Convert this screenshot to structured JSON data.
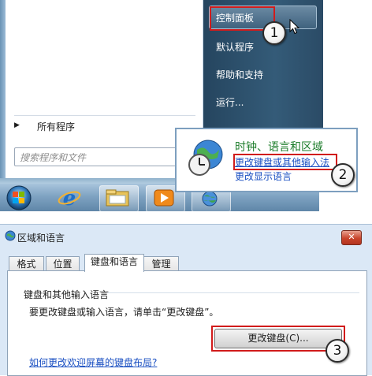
{
  "start_menu": {
    "right_items": [
      {
        "label": "控制面板"
      },
      {
        "label": "默认程序"
      },
      {
        "label": "帮助和支持"
      },
      {
        "label": "运行..."
      }
    ],
    "all_programs_label": "所有程序",
    "search_placeholder": "搜索程序和文件"
  },
  "flyout": {
    "title": "时钟、语言和区域",
    "link_change_keyboard": "更改键盘或其他输入法",
    "link_change_display_language": "更改显示语言"
  },
  "callouts": [
    "1",
    "2",
    "3"
  ],
  "taskbar": {
    "icons": [
      "windows-start-orb-icon",
      "internet-explorer-icon",
      "folder-library-icon",
      "media-player-icon",
      "network-globe-icon"
    ]
  },
  "dialog": {
    "title": "区域和语言",
    "close_glyph": "✕",
    "tabs": [
      {
        "label": "格式"
      },
      {
        "label": "位置"
      },
      {
        "label": "键盘和语言"
      },
      {
        "label": "管理"
      }
    ],
    "active_tab": "键盘和语言",
    "group_label": "键盘和其他输入语言",
    "group_text": "要更改键盘或输入语言，请单击“更改键盘”。",
    "change_keyboard_button": "更改键盘(C)...",
    "help_link": "如何更改欢迎屏幕的键盘布局?"
  },
  "colors": {
    "menu_right_pane": "#2b4b66",
    "flyout_title": "#1c7c2a",
    "link_blue": "#1a4fc2",
    "highlight_red": "#d11b1b",
    "dialog_bg": "#dbe8f6"
  }
}
